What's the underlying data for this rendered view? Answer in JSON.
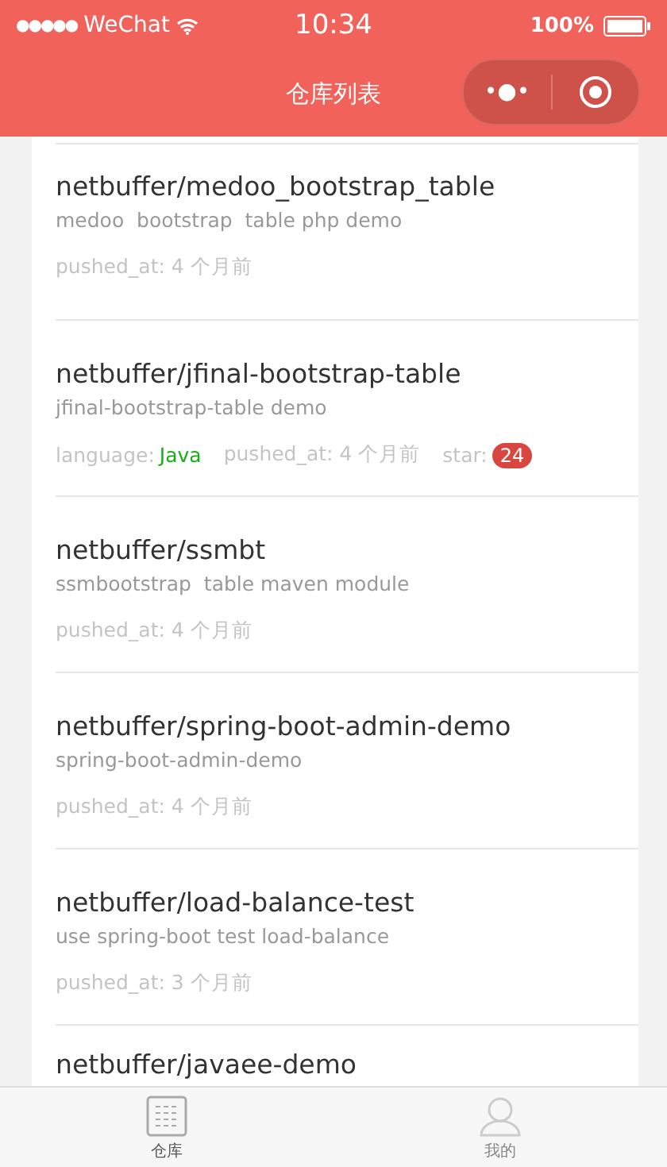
{
  "status_bar": {
    "signal": "●●●●●",
    "carrier": "WeChat",
    "time": "10:34",
    "battery": "100%"
  },
  "nav_bar": {
    "title": "仓库列表",
    "more_glyph": "•●•"
  },
  "repos": [
    {
      "name": "netbuffer/medoo_bootstrap_table",
      "description": "medoo  bootstrap  table php demo",
      "meta": [
        {
          "kind": "pushed",
          "text": "pushed_at: 4 个月前"
        }
      ]
    },
    {
      "name": "netbuffer/jfinal-bootstrap-table",
      "description": "jfinal-bootstrap-table demo",
      "meta": [
        {
          "kind": "language",
          "label": "language:",
          "value": "Java"
        },
        {
          "kind": "pushed",
          "text": "pushed_at: 4 个月前"
        },
        {
          "kind": "star",
          "label": "star:",
          "value": "24"
        }
      ]
    },
    {
      "name": "netbuffer/ssmbt",
      "description": "ssmbootstrap  table maven module",
      "meta": [
        {
          "kind": "pushed",
          "text": "pushed_at: 4 个月前"
        }
      ]
    },
    {
      "name": "netbuffer/spring-boot-admin-demo",
      "description": "spring-boot-admin-demo",
      "meta": [
        {
          "kind": "pushed",
          "text": "pushed_at: 4 个月前"
        }
      ]
    },
    {
      "name": "netbuffer/load-balance-test",
      "description": "use spring-boot test load-balance",
      "meta": [
        {
          "kind": "pushed",
          "text": "pushed_at: 3 个月前"
        }
      ]
    },
    {
      "name": "netbuffer/javaee-demo"
    }
  ],
  "tab_bar": [
    {
      "kind": "grid",
      "label": "仓库",
      "selected": true
    },
    {
      "kind": "person",
      "label": "我的",
      "selected": false
    }
  ]
}
